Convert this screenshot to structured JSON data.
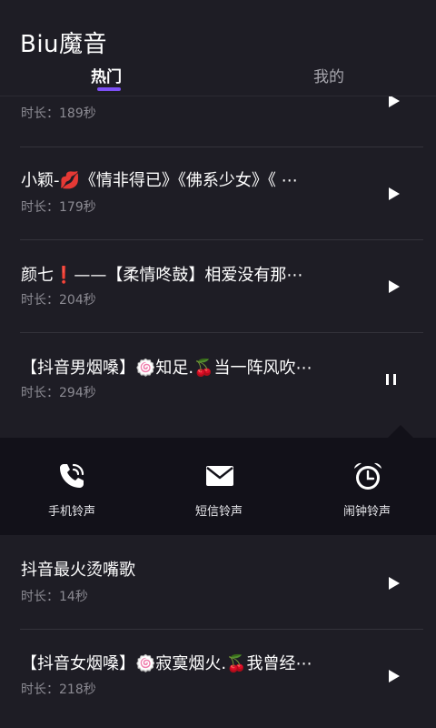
{
  "app": {
    "title": "Biu魔音"
  },
  "tabs": [
    {
      "label": "热门",
      "active": true
    },
    {
      "label": "我的",
      "active": false
    }
  ],
  "colors": {
    "background": "#1e1d25",
    "accent": "#7d50f5",
    "panel": "#121119"
  },
  "duration_prefix": "时长：",
  "songs": [
    {
      "title": "",
      "duration": "189秒",
      "state": "stopped"
    },
    {
      "title": "小颖-💋《情非得已》《佛系少女》《 ⋯",
      "duration": "179秒",
      "state": "stopped"
    },
    {
      "title": "颜七❗——【柔情咚鼓】相爱没有那⋯",
      "duration": "204秒",
      "state": "stopped"
    },
    {
      "title": "【抖音男烟嗓】🍥知足.🍒当一阵风吹⋯",
      "duration": "294秒",
      "state": "playing"
    },
    {
      "title": "抖音最火烫嘴歌",
      "duration": "14秒",
      "state": "stopped"
    },
    {
      "title": "【抖音女烟嗓】🍥寂寞烟火.🍒我曾经⋯",
      "duration": "218秒",
      "state": "stopped"
    }
  ],
  "ringtone_actions": [
    {
      "label": "手机铃声",
      "icon": "phone-icon"
    },
    {
      "label": "短信铃声",
      "icon": "envelope-icon"
    },
    {
      "label": "闹钟铃声",
      "icon": "alarm-clock-icon"
    }
  ]
}
